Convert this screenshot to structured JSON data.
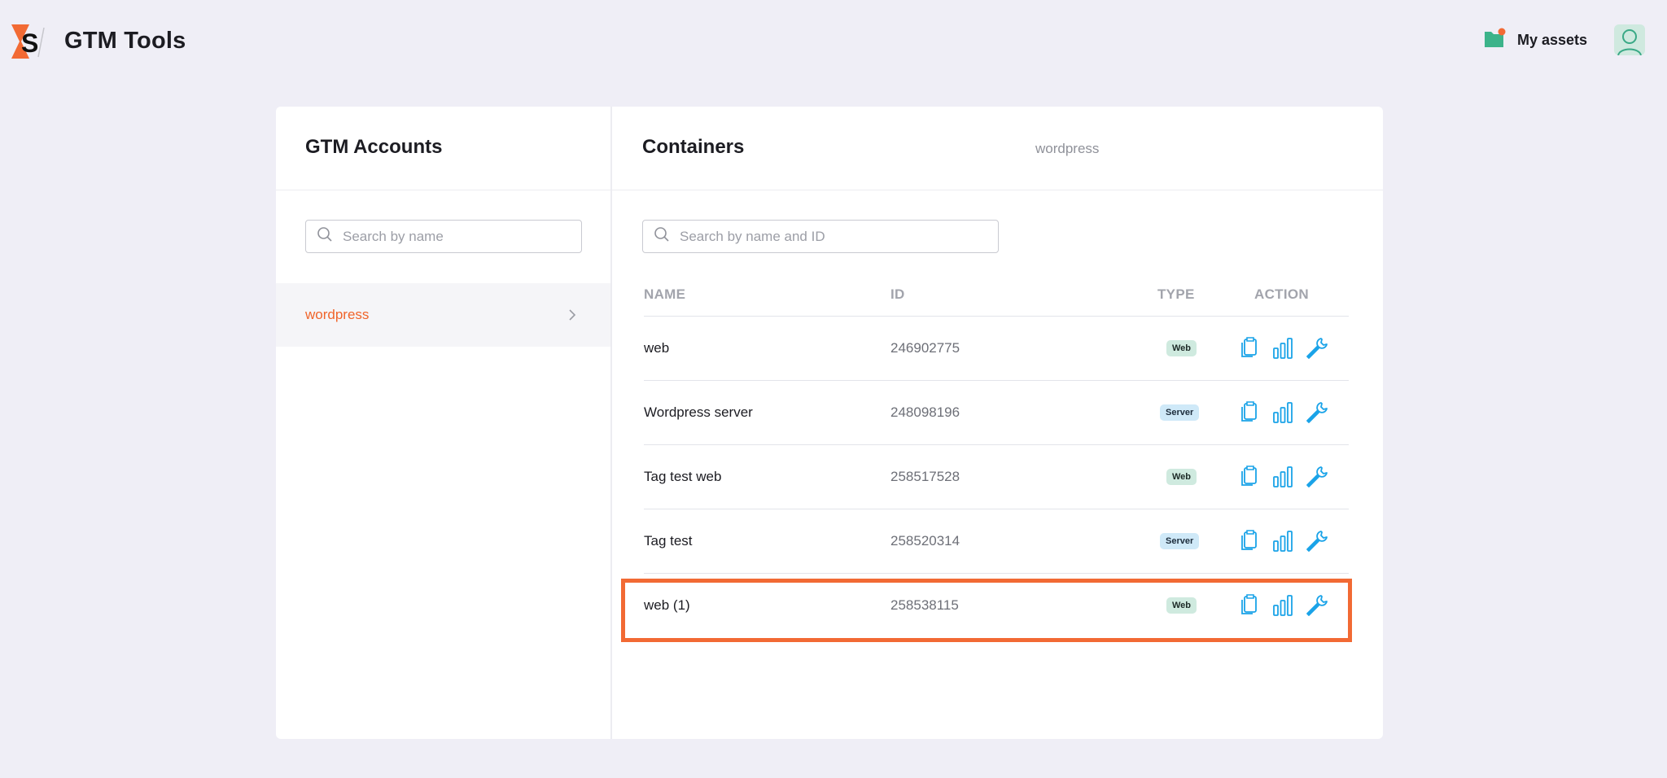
{
  "header": {
    "app_title": "GTM Tools",
    "assets_label": "My assets"
  },
  "accounts": {
    "title": "GTM Accounts",
    "search_placeholder": "Search by name",
    "items": [
      {
        "label": "wordpress"
      }
    ]
  },
  "containers": {
    "title": "Containers",
    "subtitle": "wordpress",
    "search_placeholder": "Search by name and ID",
    "columns": {
      "name": "NAME",
      "id": "ID",
      "type": "TYPE",
      "action": "ACTION"
    },
    "rows": [
      {
        "name": "web",
        "id": "246902775",
        "type": "Web"
      },
      {
        "name": "Wordpress server",
        "id": "248098196",
        "type": "Server"
      },
      {
        "name": "Tag test web",
        "id": "258517528",
        "type": "Web"
      },
      {
        "name": "Tag test",
        "id": "258520314",
        "type": "Server"
      },
      {
        "name": "web (1)",
        "id": "258538115",
        "type": "Web"
      }
    ]
  },
  "icons": {
    "action_copy": "copy-icon",
    "action_stats": "bar-chart-icon",
    "action_settings": "wrench-icon"
  },
  "colors": {
    "accent": "#f0642a",
    "icon_blue": "#1aa3e8",
    "highlight": "#f26a34",
    "web_badge": "#cfeadf",
    "server_badge": "#cfe9f8"
  }
}
